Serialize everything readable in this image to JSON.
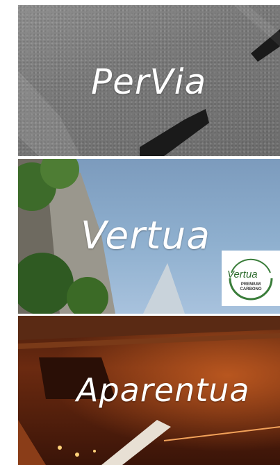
{
  "panels": [
    {
      "brand": "PerVia"
    },
    {
      "brand": "Vertua",
      "badge": {
        "title": "Vertua",
        "subtitle": "PREMIUM CARBONO"
      }
    },
    {
      "brand": "Aparentua"
    }
  ]
}
